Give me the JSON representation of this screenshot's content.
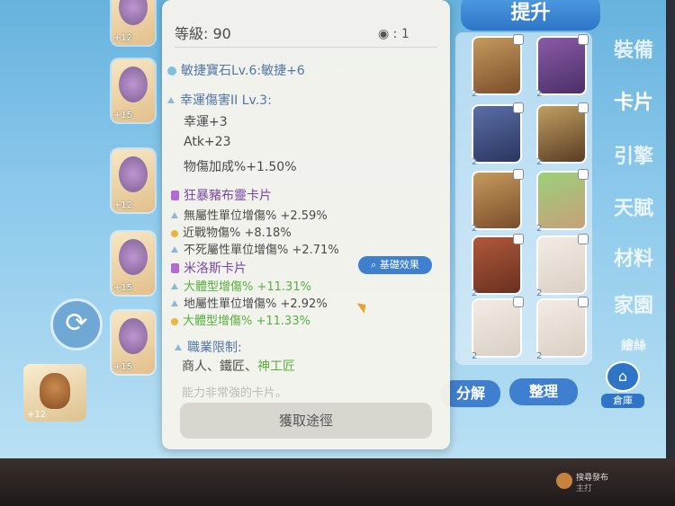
{
  "left": {
    "equip_plus": [
      "+12",
      "+15",
      "+12",
      "+15",
      "+15"
    ],
    "pet_plus": "+12",
    "refresh_glyph": "⟳"
  },
  "popup": {
    "level_label": "等級: 90",
    "view_count": "1",
    "gem": "敏捷寶石Lv.6:敏捷+6",
    "skill_title": "幸運傷害II Lv.3:",
    "skill_lines": [
      "幸運+3",
      "Atk+23",
      "物傷加成%+1.50%"
    ],
    "card1_name": "狂暴豬布靈卡片",
    "card1_lines": [
      "無屬性單位增傷% +2.59%",
      "近戰物傷% +8.18%",
      "不死屬性單位增傷% +2.71%"
    ],
    "card2_name": "米洛斯卡片",
    "compare_button": "基礎效果",
    "card2_lines": [
      "大體型增傷% +11.31%",
      "地屬性單位增傷% +2.92%",
      "大體型增傷% +11.33%"
    ],
    "job_title": "職業限制:",
    "job_list": "商人、鐵匠、",
    "job_highlight": "神工匠",
    "flavor": "能力非常強的卡片。",
    "obtain_button": "獲取途徑"
  },
  "right": {
    "upgrade_button": "提升",
    "nav": [
      "裝備",
      "卡片",
      "引擎",
      "天賦",
      "材料",
      "家園",
      "繪絲"
    ],
    "card_tag": "2",
    "split_button": "分解",
    "organize_button": "整理",
    "warehouse_label": "倉庫"
  },
  "taskbar": {
    "line1": "搜尋發布",
    "line2": "主打"
  }
}
